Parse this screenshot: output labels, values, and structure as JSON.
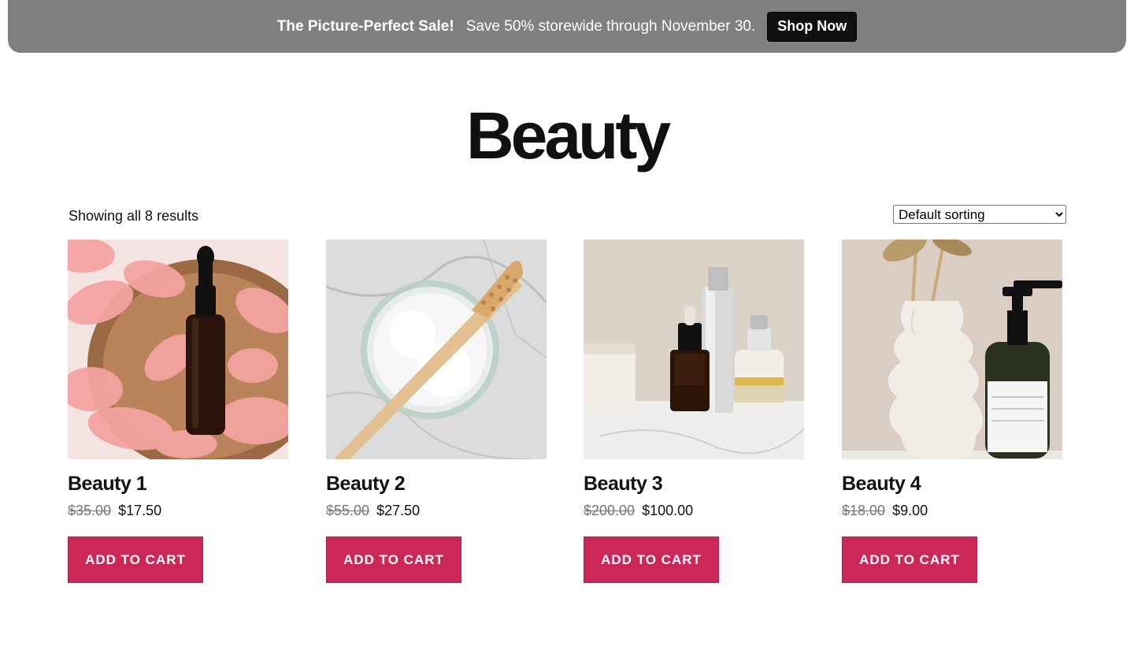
{
  "banner": {
    "headline": "The Picture-Perfect Sale!",
    "message": "Save 50% storewide through November 30.",
    "cta": "Shop Now"
  },
  "page": {
    "title": "Beauty",
    "result_count": "Showing all 8 results",
    "sort": {
      "selected": "Default sorting"
    }
  },
  "products": [
    {
      "name": "Beauty 1",
      "regular_price": "$35.00",
      "sale_price": "$17.50",
      "button": "ADD TO CART"
    },
    {
      "name": "Beauty 2",
      "regular_price": "$55.00",
      "sale_price": "$27.50",
      "button": "ADD TO CART"
    },
    {
      "name": "Beauty 3",
      "regular_price": "$200.00",
      "sale_price": "$100.00",
      "button": "ADD TO CART"
    },
    {
      "name": "Beauty 4",
      "regular_price": "$18.00",
      "sale_price": "$9.00",
      "button": "ADD TO CART"
    }
  ],
  "colors": {
    "banner_bg": "#808080",
    "cta_bg": "#111111",
    "add_to_cart": "#cb2758"
  }
}
